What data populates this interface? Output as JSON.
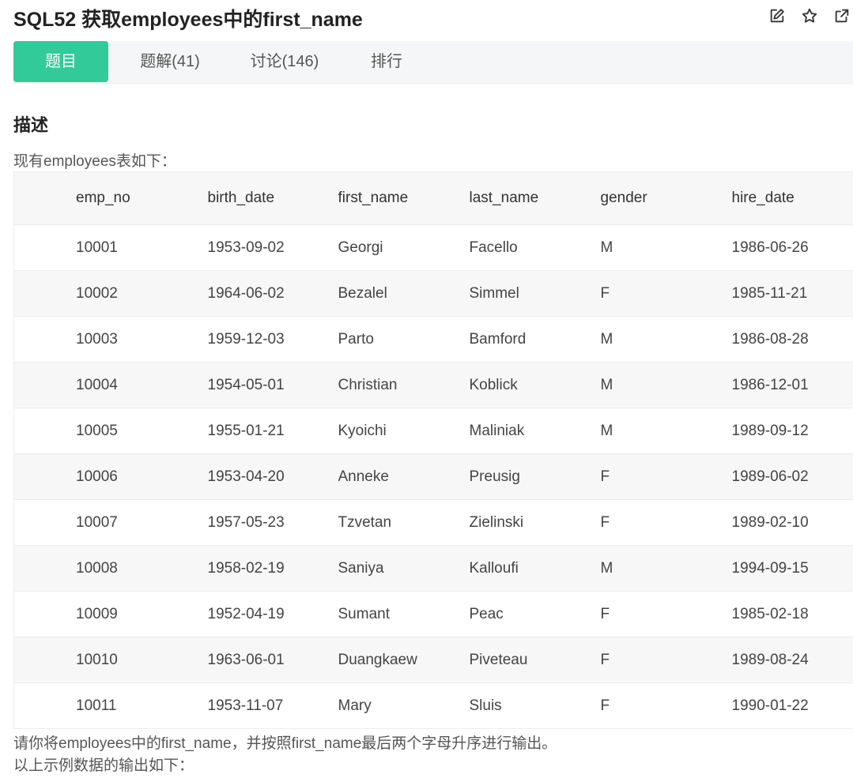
{
  "header": {
    "title": "SQL52  获取employees中的first_name",
    "icons": [
      "edit-icon",
      "star-icon",
      "open-external-icon"
    ]
  },
  "tabs": [
    {
      "label": "题目",
      "active": true
    },
    {
      "label": "题解(41)",
      "active": false
    },
    {
      "label": "讨论(146)",
      "active": false
    },
    {
      "label": "排行",
      "active": false
    }
  ],
  "description": {
    "heading": "描述",
    "intro": "现有employees表如下：",
    "table": {
      "columns": [
        "emp_no",
        "birth_date",
        "first_name",
        "last_name",
        "gender",
        "hire_date"
      ],
      "rows": [
        [
          "10001",
          "1953-09-02",
          "Georgi",
          "Facello",
          "M",
          "1986-06-26"
        ],
        [
          "10002",
          "1964-06-02",
          "Bezalel",
          "Simmel",
          "F",
          "1985-11-21"
        ],
        [
          "10003",
          "1959-12-03",
          "Parto",
          "Bamford",
          "M",
          "1986-08-28"
        ],
        [
          "10004",
          "1954-05-01",
          "Christian",
          "Koblick",
          "M",
          "1986-12-01"
        ],
        [
          "10005",
          "1955-01-21",
          "Kyoichi",
          "Maliniak",
          "M",
          "1989-09-12"
        ],
        [
          "10006",
          "1953-04-20",
          "Anneke",
          "Preusig",
          "F",
          "1989-06-02"
        ],
        [
          "10007",
          "1957-05-23",
          "Tzvetan",
          "Zielinski",
          "F",
          "1989-02-10"
        ],
        [
          "10008",
          "1958-02-19",
          "Saniya",
          "Kalloufi",
          "M",
          "1994-09-15"
        ],
        [
          "10009",
          "1952-04-19",
          "Sumant",
          "Peac",
          "F",
          "1985-02-18"
        ],
        [
          "10010",
          "1963-06-01",
          "Duangkaew",
          "Piveteau",
          "F",
          "1989-08-24"
        ],
        [
          "10011",
          "1953-11-07",
          "Mary",
          "Sluis",
          "F",
          "1990-01-22"
        ]
      ]
    },
    "task": "请你将employees中的first_name，并按照first_name最后两个字母升序进行输出。",
    "example_intro": "以上示例数据的输出如下："
  },
  "colors": {
    "accent": "#32ca99",
    "tab_bar": "#f5f6f7",
    "row_alt": "#f7f7f7"
  }
}
